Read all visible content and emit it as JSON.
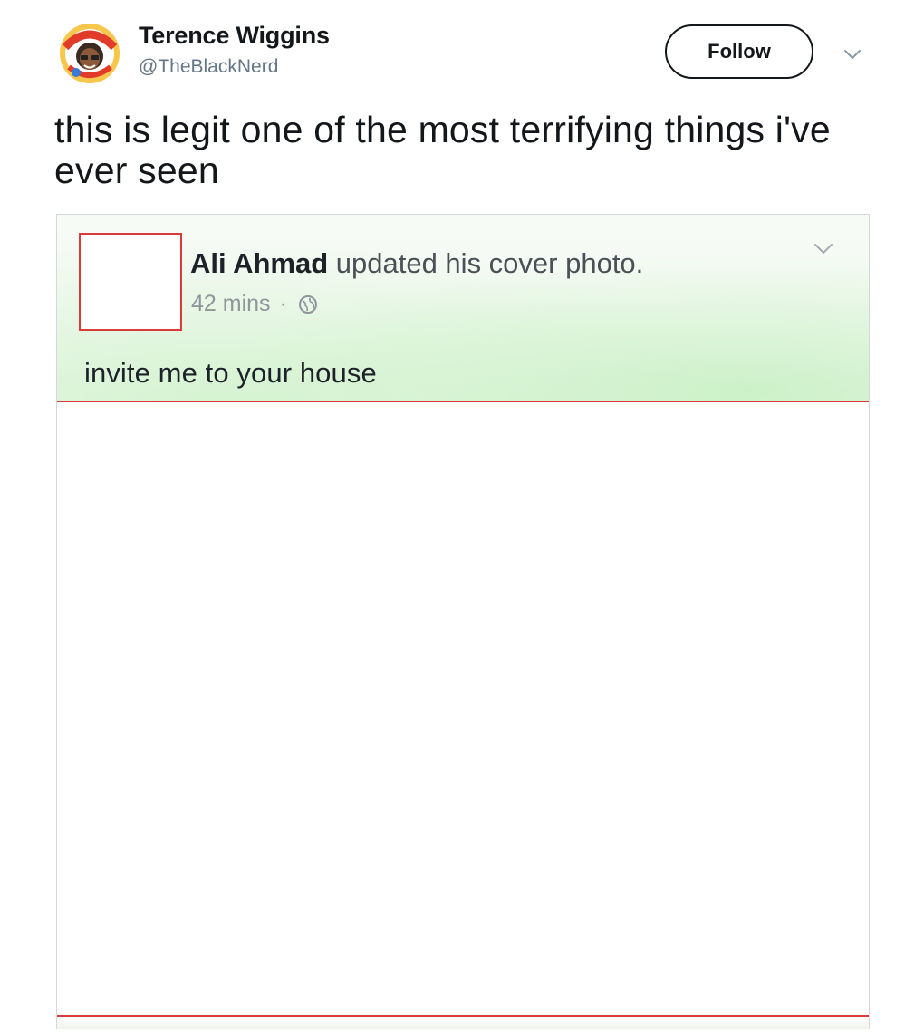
{
  "tweet": {
    "author": {
      "name": "Terence Wiggins",
      "handle": "@TheBlackNerd",
      "avatar_icon": "cartoon-avatar-icon"
    },
    "follow_label": "Follow",
    "text": "this is legit one of the most terrifying things i've ever seen"
  },
  "embedded_post": {
    "author_name": "Ali Ahmad",
    "action": "updated his cover photo.",
    "time": "42 mins",
    "separator": "·",
    "privacy_icon": "globe-icon",
    "text": "invite me to your house"
  },
  "colors": {
    "highlight_border": "#d93a3a",
    "handle_gray": "#657786",
    "text_dark": "#14171a"
  }
}
